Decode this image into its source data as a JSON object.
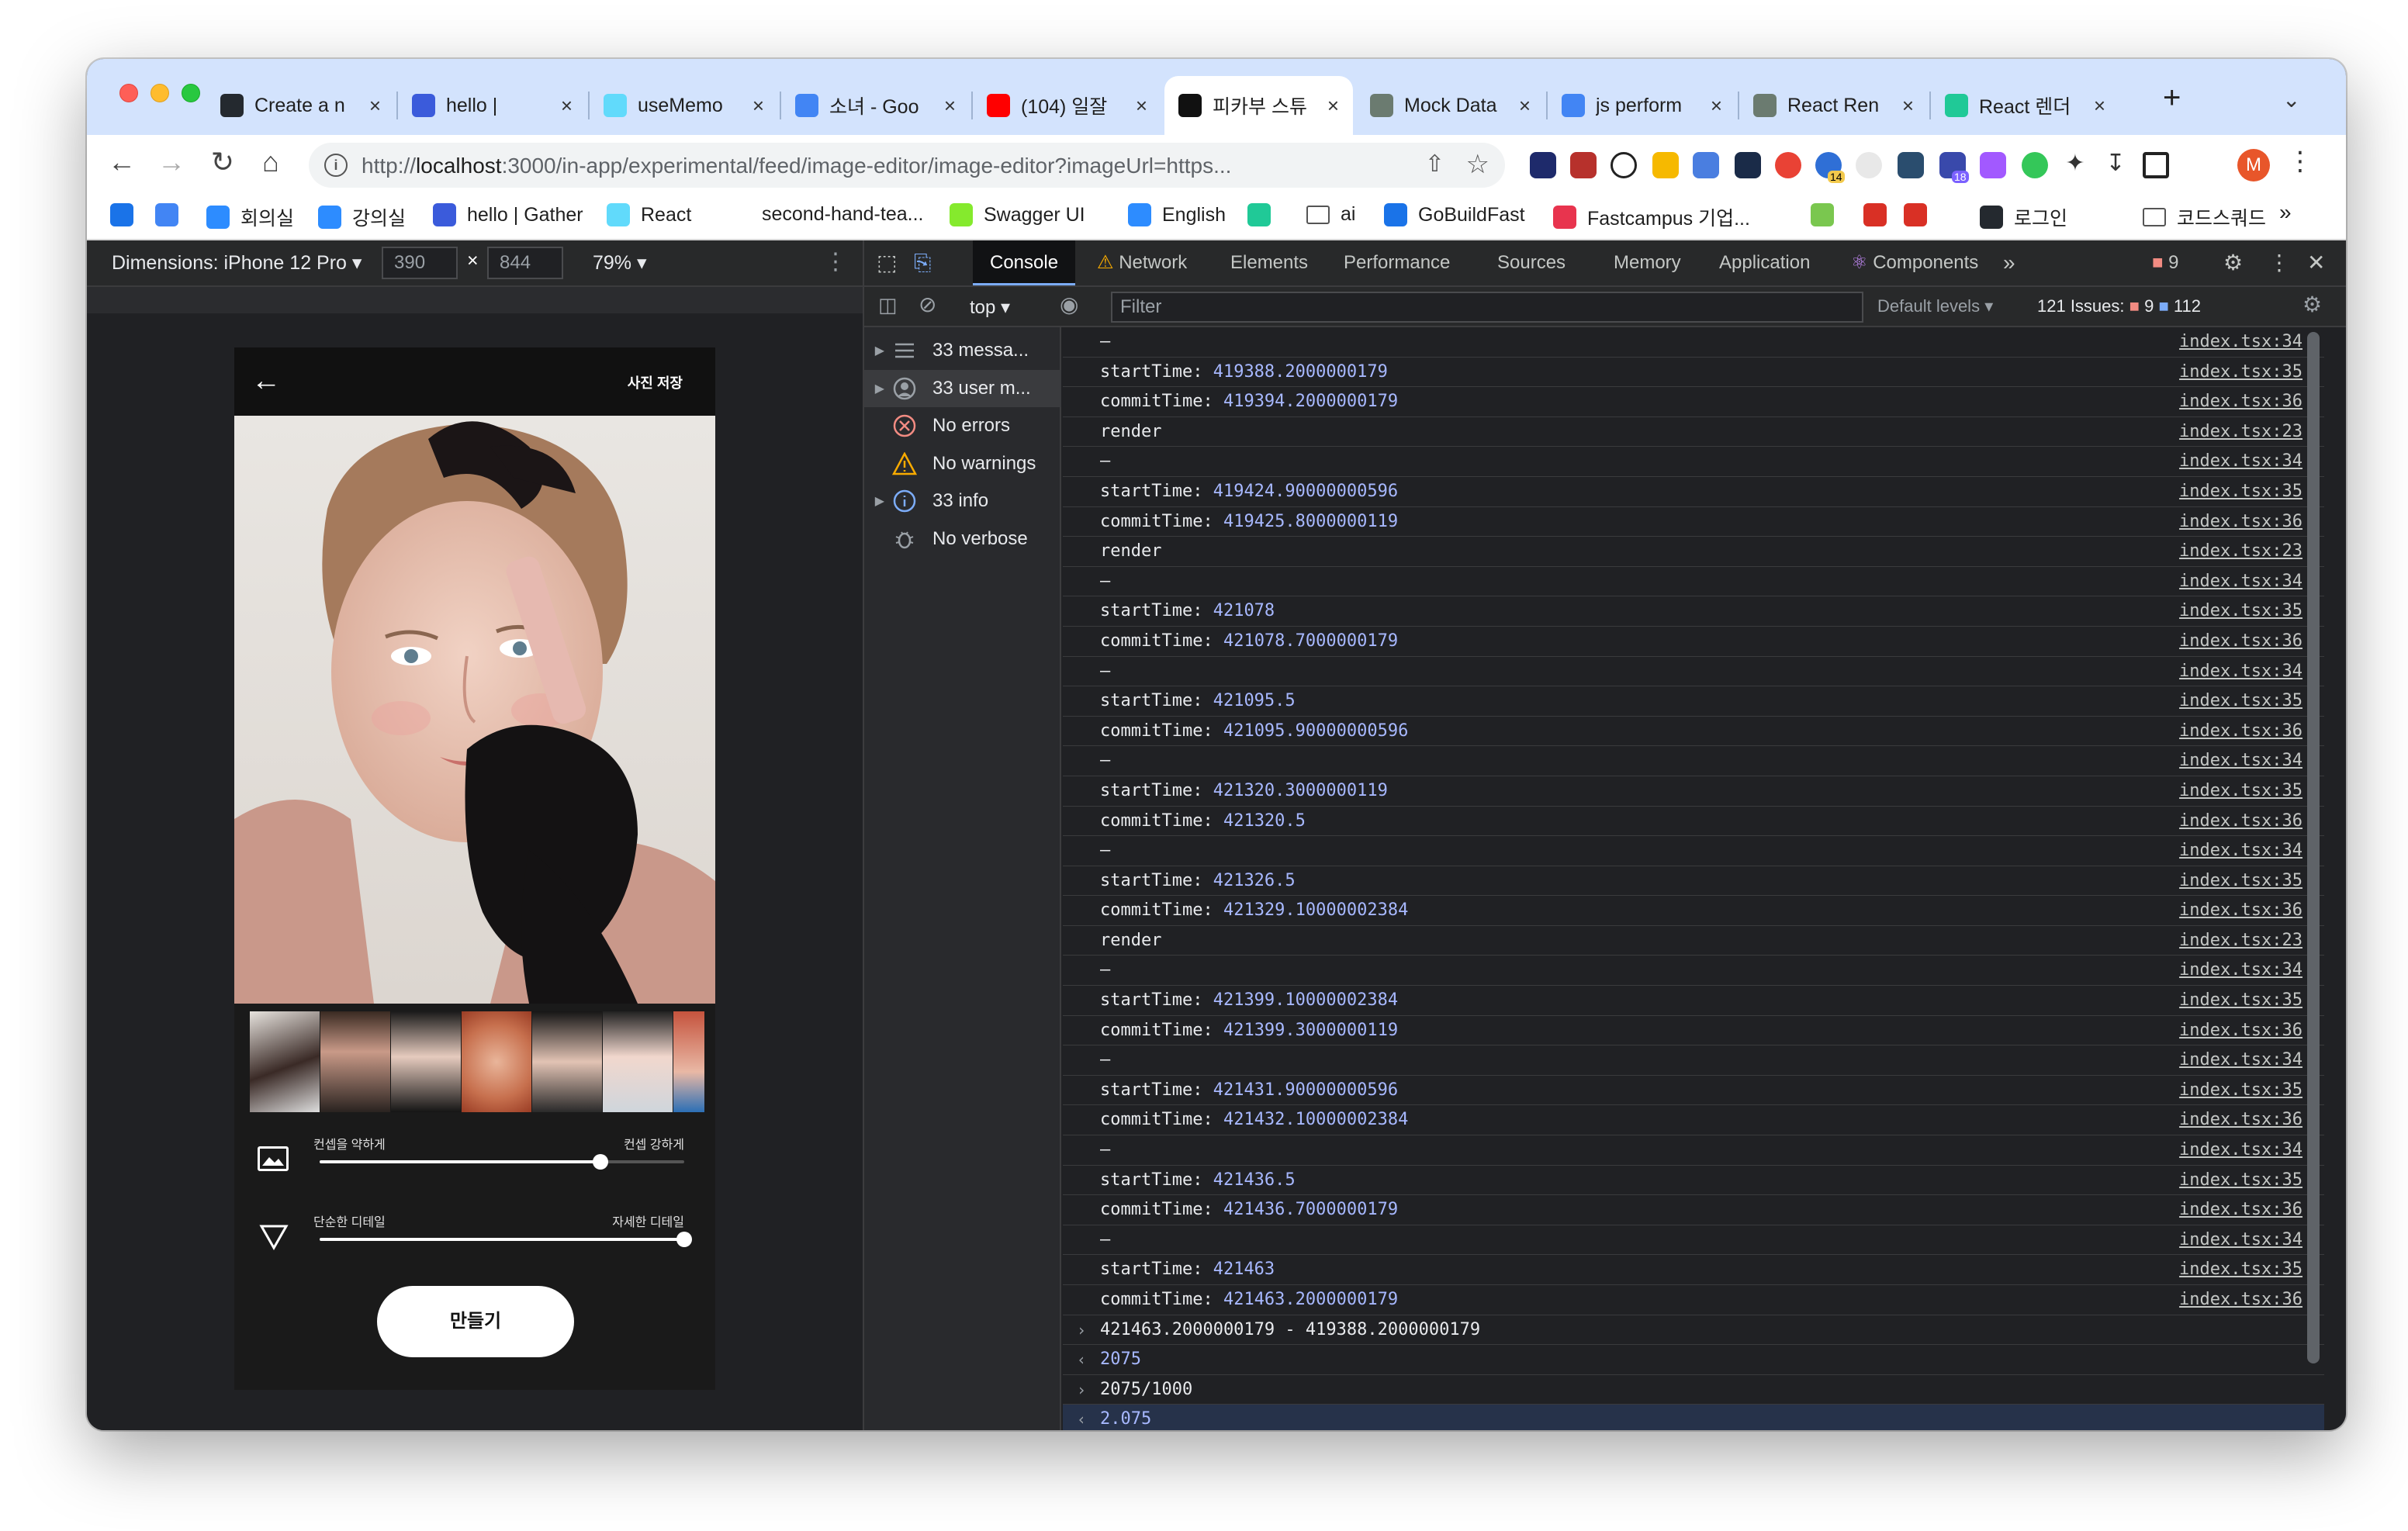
{
  "browser": {
    "tabs": [
      {
        "title": "Create a n",
        "fav": "github-icon",
        "color": "#24292f",
        "active": false
      },
      {
        "title": "hello | ",
        "fav": "gather-icon",
        "color": "#3b5bdb",
        "active": false
      },
      {
        "title": "useMemo",
        "fav": "react-icon",
        "color": "#61dafb",
        "active": false
      },
      {
        "title": "소녀 - Goo",
        "fav": "google-icon",
        "color": "#4285f4",
        "active": false
      },
      {
        "title": "(104) 일잘",
        "fav": "youtube-icon",
        "color": "#ff0000",
        "active": false
      },
      {
        "title": "피카부 스튜",
        "fav": "app-icon",
        "color": "#111111",
        "active": true
      },
      {
        "title": "Mock Data",
        "fav": "chatgpt-icon",
        "color": "#6b7b70",
        "active": false
      },
      {
        "title": "js perform",
        "fav": "google-icon",
        "color": "#4285f4",
        "active": false
      },
      {
        "title": "React Ren",
        "fav": "chatgpt-icon",
        "color": "#6b7b70",
        "active": false
      },
      {
        "title": "React 렌더",
        "fav": "velog-icon",
        "color": "#20c997",
        "active": false
      }
    ],
    "new_tab": "+",
    "url_prefix": "http://",
    "url_host": "localhost",
    "url_rest": ":3000/in-app/experimental/feed/image-editor/image-editor?imageUrl=https...",
    "profile_initial": "M",
    "ext_badges": [
      "14",
      "18"
    ],
    "bookmarks": [
      {
        "label": "",
        "icon": "wave-icon",
        "color": "#1a73e8"
      },
      {
        "label": "",
        "icon": "calendar-icon",
        "color": "#4285f4"
      },
      {
        "label": "회의실",
        "icon": "zoom-icon",
        "color": "#2d8cff"
      },
      {
        "label": "강의실",
        "icon": "zoom-icon",
        "color": "#2d8cff"
      },
      {
        "label": "hello | Gather",
        "icon": "gather-icon",
        "color": "#3b5bdb"
      },
      {
        "label": "React",
        "icon": "react-icon",
        "color": "#61dafb"
      },
      {
        "label": "second-hand-tea...",
        "icon": "",
        "color": ""
      },
      {
        "label": "Swagger UI",
        "icon": "swagger-icon",
        "color": "#85ea2d"
      },
      {
        "label": "English",
        "icon": "zoom-icon",
        "color": "#2d8cff"
      },
      {
        "label": "",
        "icon": "velog-icon",
        "color": "#20c997"
      },
      {
        "label": "ai",
        "icon": "folder-icon",
        "color": ""
      },
      {
        "label": "GoBuildFast",
        "icon": "gobuild-icon",
        "color": "#1a73e8"
      },
      {
        "label": "Fastcampus 기업...",
        "icon": "fastcampus-icon",
        "color": "#e8344e"
      },
      {
        "label": "",
        "icon": "flower-icon",
        "color": "#7ac74f"
      },
      {
        "label": "",
        "icon": "question-icon",
        "color": "#d93025"
      },
      {
        "label": "",
        "icon": "figure-icon",
        "color": "#d93025"
      },
      {
        "label": "로그인",
        "icon": "github-icon",
        "color": "#24292f"
      },
      {
        "label": "코드스쿼드",
        "icon": "folder-icon",
        "color": ""
      }
    ],
    "bookmarks_more": "»"
  },
  "device": {
    "dimensions_label": "Dimensions: iPhone 12 Pro",
    "width": "390",
    "height": "844",
    "zoom": "79%",
    "times": "×"
  },
  "phone": {
    "save_label": "사진 저장",
    "slider1": {
      "left": "컨셉을 약하게",
      "right": "컨셉 강하게",
      "value": 0.77
    },
    "slider2": {
      "left": "단순한 디테일",
      "right": "자세한 디테일",
      "value": 1.0
    },
    "make_label": "만들기"
  },
  "devtools": {
    "tabs": [
      "Console",
      "Network",
      "Elements",
      "Performance",
      "Sources",
      "Memory",
      "Application",
      "Components"
    ],
    "more_tabs": "»",
    "error_count": "9",
    "context": "top",
    "filter_placeholder": "Filter",
    "levels": "Default levels",
    "issues_label": "121 Issues:",
    "issues_errors": "9",
    "issues_info": "112",
    "sidebar": [
      {
        "label": "33 messa...",
        "icon": "list-icon",
        "arrow": true,
        "selected": false
      },
      {
        "label": "33 user m...",
        "icon": "user-icon",
        "arrow": true,
        "selected": true
      },
      {
        "label": "No errors",
        "icon": "error-icon",
        "arrow": false,
        "selected": false
      },
      {
        "label": "No warnings",
        "icon": "warning-icon",
        "arrow": false,
        "selected": false
      },
      {
        "label": "33 info",
        "icon": "info-icon",
        "arrow": true,
        "selected": false
      },
      {
        "label": "No verbose",
        "icon": "bug-icon",
        "arrow": false,
        "selected": false
      }
    ],
    "console_rows": [
      {
        "type": "log",
        "key": "",
        "text": "–",
        "src": "index.tsx:34"
      },
      {
        "type": "log",
        "key": "startTime:",
        "text": "419388.2000000179",
        "src": "index.tsx:35"
      },
      {
        "type": "log",
        "key": "commitTime:",
        "text": "419394.2000000179",
        "src": "index.tsx:36"
      },
      {
        "type": "log",
        "key": "",
        "text": "render",
        "src": "index.tsx:23"
      },
      {
        "type": "log",
        "key": "",
        "text": "–",
        "src": "index.tsx:34"
      },
      {
        "type": "log",
        "key": "startTime:",
        "text": "419424.90000000596",
        "src": "index.tsx:35"
      },
      {
        "type": "log",
        "key": "commitTime:",
        "text": "419425.8000000119",
        "src": "index.tsx:36"
      },
      {
        "type": "log",
        "key": "",
        "text": "render",
        "src": "index.tsx:23"
      },
      {
        "type": "log",
        "key": "",
        "text": "–",
        "src": "index.tsx:34"
      },
      {
        "type": "log",
        "key": "startTime:",
        "text": "421078",
        "src": "index.tsx:35"
      },
      {
        "type": "log",
        "key": "commitTime:",
        "text": "421078.7000000179",
        "src": "index.tsx:36"
      },
      {
        "type": "log",
        "key": "",
        "text": "–",
        "src": "index.tsx:34"
      },
      {
        "type": "log",
        "key": "startTime:",
        "text": "421095.5",
        "src": "index.tsx:35"
      },
      {
        "type": "log",
        "key": "commitTime:",
        "text": "421095.90000000596",
        "src": "index.tsx:36"
      },
      {
        "type": "log",
        "key": "",
        "text": "–",
        "src": "index.tsx:34"
      },
      {
        "type": "log",
        "key": "startTime:",
        "text": "421320.3000000119",
        "src": "index.tsx:35"
      },
      {
        "type": "log",
        "key": "commitTime:",
        "text": "421320.5",
        "src": "index.tsx:36"
      },
      {
        "type": "log",
        "key": "",
        "text": "–",
        "src": "index.tsx:34"
      },
      {
        "type": "log",
        "key": "startTime:",
        "text": "421326.5",
        "src": "index.tsx:35"
      },
      {
        "type": "log",
        "key": "commitTime:",
        "text": "421329.10000002384",
        "src": "index.tsx:36"
      },
      {
        "type": "log",
        "key": "",
        "text": "render",
        "src": "index.tsx:23"
      },
      {
        "type": "log",
        "key": "",
        "text": "–",
        "src": "index.tsx:34"
      },
      {
        "type": "log",
        "key": "startTime:",
        "text": "421399.10000002384",
        "src": "index.tsx:35"
      },
      {
        "type": "log",
        "key": "commitTime:",
        "text": "421399.3000000119",
        "src": "index.tsx:36"
      },
      {
        "type": "log",
        "key": "",
        "text": "–",
        "src": "index.tsx:34"
      },
      {
        "type": "log",
        "key": "startTime:",
        "text": "421431.90000000596",
        "src": "index.tsx:35"
      },
      {
        "type": "log",
        "key": "commitTime:",
        "text": "421432.10000002384",
        "src": "index.tsx:36"
      },
      {
        "type": "log",
        "key": "",
        "text": "–",
        "src": "index.tsx:34"
      },
      {
        "type": "log",
        "key": "startTime:",
        "text": "421436.5",
        "src": "index.tsx:35"
      },
      {
        "type": "log",
        "key": "commitTime:",
        "text": "421436.7000000179",
        "src": "index.tsx:36"
      },
      {
        "type": "log",
        "key": "",
        "text": "–",
        "src": "index.tsx:34"
      },
      {
        "type": "log",
        "key": "startTime:",
        "text": "421463",
        "src": "index.tsx:35"
      },
      {
        "type": "log",
        "key": "commitTime:",
        "text": "421463.2000000179",
        "src": "index.tsx:36"
      },
      {
        "type": "input",
        "key": "",
        "text": "421463.2000000179 - 419388.2000000179",
        "src": ""
      },
      {
        "type": "result",
        "key": "",
        "text": "2075",
        "src": ""
      },
      {
        "type": "input",
        "key": "",
        "text": "    2075/1000",
        "src": ""
      },
      {
        "type": "current",
        "key": "",
        "text": "2.075",
        "src": ""
      }
    ]
  },
  "colors": {
    "tabstrip": "#d3e3fd",
    "devtools_bg": "#202124",
    "number": "#a7b8ff",
    "accent_blue": "#7cacf8"
  }
}
